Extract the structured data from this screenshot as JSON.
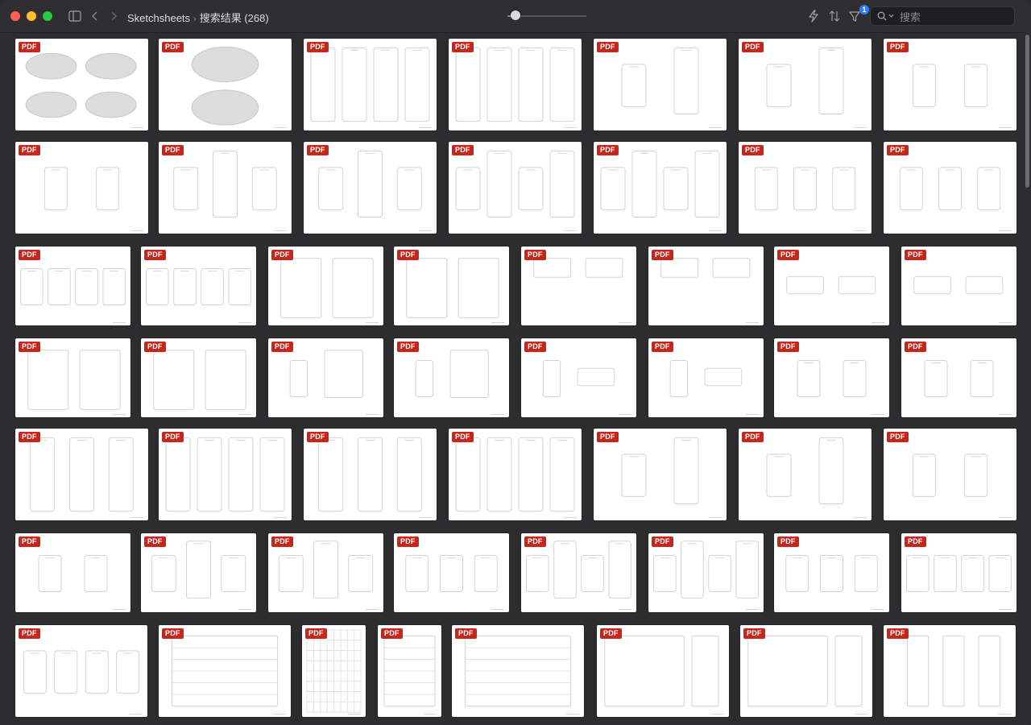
{
  "window": {
    "breadcrumb": [
      "Sketchsheets",
      "搜索结果 (268)"
    ],
    "zoom_level": 0.1
  },
  "toolbar": {
    "sidebar_toggle_icon": "sidebar-icon",
    "back_icon": "chevron-left-icon",
    "forward_icon": "chevron-right-icon",
    "action_icon": "bolt-icon",
    "sort_icon": "sort-arrows-icon",
    "filter_icon": "filter-icon",
    "filter_count": "1",
    "search": {
      "placeholder": "搜索",
      "value": ""
    }
  },
  "colors": {
    "pdf_badge": "#c8261a",
    "accent": "#2f7dfa",
    "window_bg": "#2d2d2f"
  },
  "grid": {
    "badge_label": "PDF",
    "items_count": 52,
    "item_type": "PDF"
  }
}
